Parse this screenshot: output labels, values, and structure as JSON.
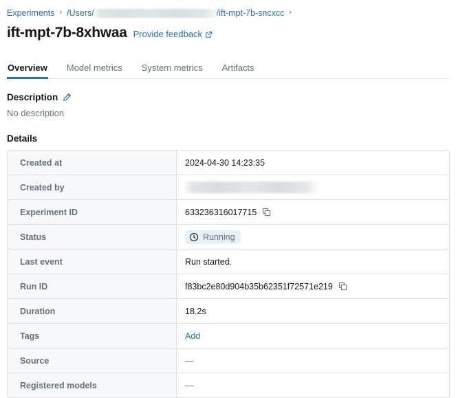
{
  "breadcrumb": {
    "root_label": "Experiments",
    "separator": "›",
    "path_prefix": "/Users/",
    "path_redacted": true,
    "path_suffix": "/ift-mpt-7b-sncxcc",
    "trailing_separator": "›"
  },
  "header": {
    "title": "ift-mpt-7b-8xhwaa",
    "feedback_label": "Provide feedback",
    "feedback_icon": "external-link-icon"
  },
  "tabs": [
    {
      "label": "Overview",
      "active": true
    },
    {
      "label": "Model metrics",
      "active": false
    },
    {
      "label": "System metrics",
      "active": false
    },
    {
      "label": "Artifacts",
      "active": false
    }
  ],
  "description": {
    "heading": "Description",
    "edit_icon": "pencil-icon",
    "body": "No description"
  },
  "details": {
    "heading": "Details",
    "rows": [
      {
        "label": "Created at",
        "value": "2024-04-30 14:23:35",
        "type": "text"
      },
      {
        "label": "Created by",
        "value": "",
        "type": "redacted"
      },
      {
        "label": "Experiment ID",
        "value": "633236316017715",
        "type": "copyable"
      },
      {
        "label": "Status",
        "value": "Running",
        "type": "status"
      },
      {
        "label": "Last event",
        "value": "Run started.",
        "type": "text"
      },
      {
        "label": "Run ID",
        "value": "f83bc2e80d904b35b62351f72571e219",
        "type": "copyable"
      },
      {
        "label": "Duration",
        "value": "18.2s",
        "type": "text"
      },
      {
        "label": "Tags",
        "value": "Add",
        "type": "link"
      },
      {
        "label": "Source",
        "value": "—",
        "type": "dash"
      },
      {
        "label": "Registered models",
        "value": "—",
        "type": "dash"
      }
    ]
  },
  "status": {
    "icon": "clock-icon",
    "label": "Running"
  },
  "colors": {
    "link": "#2272B4",
    "accent_underline": "#2272B4",
    "label_text": "#5F7281",
    "body_text": "#11171C",
    "row_label_bg": "#F8F9FA",
    "border": "#DCE0E3",
    "status_badge_bg": "#E8F1FB"
  }
}
